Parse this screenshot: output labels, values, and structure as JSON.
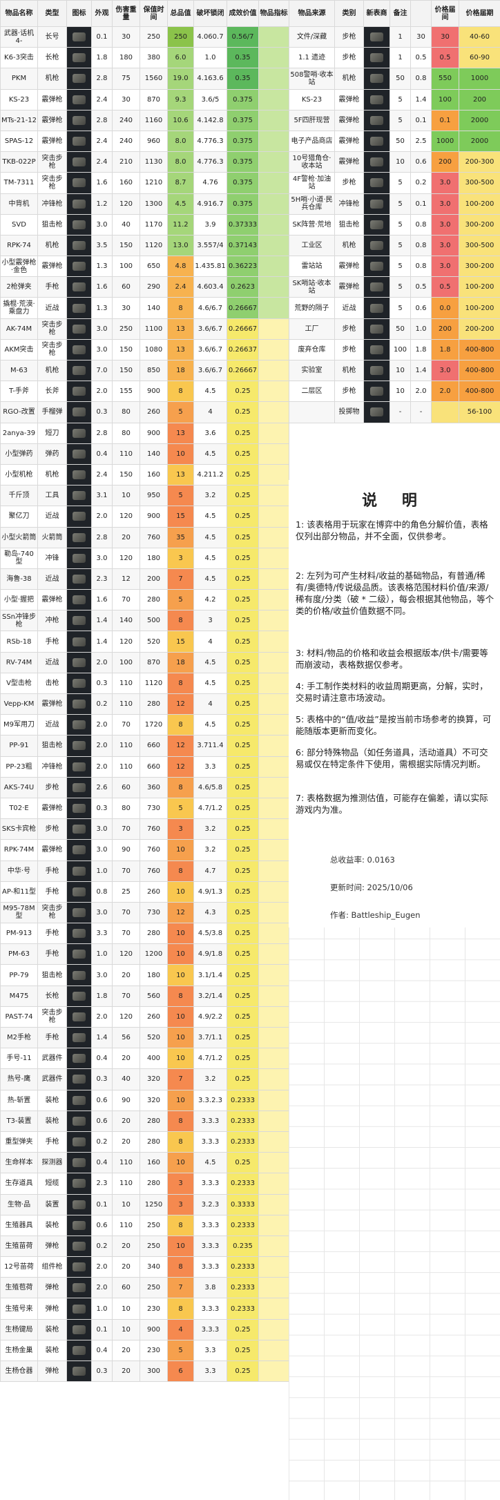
{
  "left_headers": [
    "物品名称",
    "类型",
    "图标",
    "外观",
    "伤害重量",
    "保值时间",
    "总品值",
    "破坏锁闭",
    "成效价值",
    "物品指标"
  ],
  "right_headers": [
    "物品来源",
    "类别",
    "新表商",
    "备注",
    "",
    "价格届间",
    "价格届期"
  ],
  "left_rows": [
    [
      "武器·话机4-",
      "长号",
      "",
      "0.1",
      "30",
      "250",
      "250",
      "4.060.7",
      "0.56/7"
    ],
    [
      "K6-3突击",
      "长枪",
      "",
      "1.8",
      "180",
      "380",
      "6.0",
      "1.0",
      "0.35"
    ],
    [
      "PKM",
      "机枪",
      "",
      "2.8",
      "75",
      "1560",
      "19.0",
      "4.163.6",
      "0.35"
    ],
    [
      "KS-23",
      "霰弹枪",
      "",
      "2.4",
      "30",
      "870",
      "9.3",
      "3.6/5",
      "0.375"
    ],
    [
      "MTs-21-12",
      "霰弹枪",
      "",
      "2.8",
      "240",
      "1160",
      "10.6",
      "4.142.8",
      "0.375"
    ],
    [
      "SPAS-12",
      "霰弹枪",
      "",
      "2.4",
      "240",
      "960",
      "8.0",
      "4.776.3",
      "0.375"
    ],
    [
      "TKB-022P",
      "突击步枪",
      "",
      "2.4",
      "210",
      "1130",
      "8.0",
      "4.776.3",
      "0.375"
    ],
    [
      "TM-7311",
      "突击步枪",
      "",
      "1.6",
      "160",
      "1210",
      "8.7",
      "4.76",
      "0.375"
    ],
    [
      "中背机",
      "冲锋枪",
      "",
      "1.2",
      "120",
      "1300",
      "4.5",
      "4.916.7",
      "0.375"
    ],
    [
      "SVD",
      "狙击枪",
      "",
      "3.0",
      "40",
      "1170",
      "11.2",
      "3.9",
      "0.37333"
    ],
    [
      "RPK-74",
      "机枪",
      "",
      "3.5",
      "150",
      "1120",
      "13.0",
      "3.557/4",
      "0.37143"
    ],
    [
      "小型霰弹枪·金色",
      "霰弹枪",
      "",
      "1.3",
      "100",
      "650",
      "4.8",
      "1.435.81",
      "0.36223"
    ],
    [
      "2枪弹夹",
      "手枪",
      "",
      "1.6",
      "60",
      "290",
      "2.4",
      "4.603.4",
      "0.2623"
    ],
    [
      "撬棍·荒漠·乘盘力",
      "近战",
      "",
      "1.3",
      "30",
      "140",
      "8",
      "4.6/6.7",
      "0.26667"
    ],
    [
      "AK-74M",
      "突击步枪",
      "",
      "3.0",
      "250",
      "1100",
      "13",
      "3.6/6.7",
      "0.26667"
    ],
    [
      "AKM突击",
      "突击步枪",
      "",
      "3.0",
      "150",
      "1080",
      "13",
      "3.6/6.7",
      "0.26637"
    ],
    [
      "M-63",
      "机枪",
      "",
      "7.0",
      "150",
      "850",
      "18",
      "3.6/6.7",
      "0.26667"
    ],
    [
      "T-手斧",
      "长斧",
      "",
      "2.0",
      "155",
      "900",
      "8",
      "4.5",
      "0.25"
    ],
    [
      "RGO-改置",
      "手榴弹",
      "",
      "0.3",
      "80",
      "260",
      "5",
      "4",
      "0.25"
    ],
    [
      "2anya-39",
      "短刀",
      "",
      "2.8",
      "80",
      "900",
      "13",
      "3.6",
      "0.25"
    ],
    [
      "小型弹药",
      "弹药",
      "",
      "0.4",
      "110",
      "140",
      "10",
      "4.5",
      "0.25"
    ],
    [
      "小型机枪",
      "机枪",
      "",
      "2.4",
      "150",
      "160",
      "13",
      "4.211.2",
      "0.25"
    ],
    [
      "千斤顶",
      "工具",
      "",
      "3.1",
      "10",
      "950",
      "5",
      "3.2",
      "0.25"
    ],
    [
      "聚亿刀",
      "近战",
      "",
      "2.0",
      "120",
      "900",
      "15",
      "4.5",
      "0.25"
    ],
    [
      "小型火箭筒",
      "火箭筒",
      "",
      "2.8",
      "20",
      "760",
      "35",
      "4.5",
      "0.25"
    ],
    [
      "勒岛-740型",
      "冲锋",
      "",
      "3.0",
      "120",
      "180",
      "3",
      "4.5",
      "0.25"
    ],
    [
      "海鲁-38",
      "近战",
      "",
      "2.3",
      "12",
      "200",
      "7",
      "4.5",
      "0.25"
    ],
    [
      "小型·握把",
      "霰弹枪",
      "",
      "1.6",
      "70",
      "280",
      "5",
      "4.2",
      "0.25"
    ],
    [
      "SSn冲锋步枪",
      "冲枪",
      "",
      "1.4",
      "140",
      "500",
      "8",
      "3",
      "0.25"
    ],
    [
      "RSb-18",
      "手枪",
      "",
      "1.4",
      "120",
      "520",
      "15",
      "4",
      "0.25"
    ],
    [
      "RV-74M",
      "近战",
      "",
      "2.0",
      "100",
      "870",
      "18",
      "4.5",
      "0.25"
    ],
    [
      "V型击枪",
      "击枪",
      "",
      "0.3",
      "110",
      "1120",
      "8",
      "4.5",
      "0.25"
    ],
    [
      "Vepp-KM",
      "霰弹枪",
      "",
      "0.2",
      "110",
      "280",
      "12",
      "4",
      "0.25"
    ],
    [
      "M9军用刀",
      "近战",
      "",
      "2.0",
      "70",
      "1720",
      "8",
      "4.5",
      "0.25"
    ],
    [
      "PP-91",
      "狙击枪",
      "",
      "2.0",
      "110",
      "660",
      "12",
      "3.711.4",
      "0.25"
    ],
    [
      "PP-23粗",
      "冲锋枪",
      "",
      "2.0",
      "110",
      "660",
      "12",
      "3.3",
      "0.25"
    ],
    [
      "AKS-74U",
      "步枪",
      "",
      "2.6",
      "60",
      "360",
      "8",
      "4.6/5.8",
      "0.25"
    ],
    [
      "T02·E",
      "霰弹枪",
      "",
      "0.3",
      "80",
      "730",
      "5",
      "4.7/1.2",
      "0.25"
    ],
    [
      "SKS卡宾枪",
      "步枪",
      "",
      "3.0",
      "70",
      "760",
      "3",
      "3.2",
      "0.25"
    ],
    [
      "RPK-74M",
      "霰弹枪",
      "",
      "3.0",
      "90",
      "760",
      "10",
      "3.2",
      "0.25"
    ],
    [
      "中华·号",
      "手枪",
      "",
      "1.0",
      "70",
      "760",
      "8",
      "4.7",
      "0.25"
    ],
    [
      "AP-和11型",
      "手枪",
      "",
      "0.8",
      "25",
      "260",
      "10",
      "4.9/1.3",
      "0.25"
    ],
    [
      "M95-78M型",
      "突击步枪",
      "",
      "3.0",
      "70",
      "730",
      "12",
      "4.3",
      "0.25"
    ],
    [
      "PM-913",
      "手枪",
      "",
      "3.3",
      "70",
      "280",
      "10",
      "4.5/3.8",
      "0.25"
    ],
    [
      "PM-63",
      "手枪",
      "",
      "1.0",
      "120",
      "1200",
      "10",
      "4.9/1.8",
      "0.25"
    ],
    [
      "PP-79",
      "狙击枪",
      "",
      "3.0",
      "20",
      "180",
      "10",
      "3.1/1.4",
      "0.25"
    ],
    [
      "M475",
      "长枪",
      "",
      "1.8",
      "70",
      "560",
      "8",
      "3.2/1.4",
      "0.25"
    ],
    [
      "PAST-74",
      "突击步枪",
      "",
      "2.0",
      "120",
      "260",
      "10",
      "4.9/2.2",
      "0.25"
    ],
    [
      "M2手枪",
      "手枪",
      "",
      "1.4",
      "56",
      "520",
      "10",
      "3.7/1.1",
      "0.25"
    ],
    [
      "手号-11",
      "武器件",
      "",
      "0.4",
      "20",
      "400",
      "10",
      "4.7/1.2",
      "0.25"
    ],
    [
      "热号-鹰",
      "武器件",
      "",
      "0.3",
      "40",
      "320",
      "7",
      "3.2",
      "0.25"
    ],
    [
      "热-斩置",
      "装枪",
      "",
      "0.6",
      "90",
      "320",
      "10",
      "3.3.2.3",
      "0.2333"
    ],
    [
      "T3-装置",
      "装枪",
      "",
      "0.6",
      "20",
      "280",
      "8",
      "3.3.3",
      "0.2333"
    ],
    [
      "重型弹夹",
      "手枪",
      "",
      "0.2",
      "20",
      "280",
      "8",
      "3.3.3",
      "0.2333"
    ],
    [
      "生命样本",
      "探测器",
      "",
      "0.4",
      "110",
      "160",
      "10",
      "4.5",
      "0.25"
    ],
    [
      "生存道具",
      "短缆",
      "",
      "2.3",
      "110",
      "280",
      "3",
      "3.3.3",
      "0.2333"
    ],
    [
      "生物·品",
      "装置",
      "",
      "0.1",
      "10",
      "1250",
      "3",
      "3.2.3",
      "0.3333"
    ],
    [
      "生殖器具",
      "装枪",
      "",
      "0.6",
      "110",
      "250",
      "8",
      "3.3.3",
      "0.2333"
    ],
    [
      "生殖苗荷",
      "弹枪",
      "",
      "0.2",
      "20",
      "250",
      "10",
      "3.3.3",
      "0.235"
    ],
    [
      "12号苗荷",
      "组件枪",
      "",
      "2.0",
      "20",
      "340",
      "8",
      "3.3.3",
      "0.2333"
    ],
    [
      "生殖苞荷",
      "弹枪",
      "",
      "2.0",
      "60",
      "250",
      "7",
      "3.8",
      "0.2333"
    ],
    [
      "生殖号来",
      "弹枪",
      "",
      "1.0",
      "10",
      "230",
      "8",
      "3.3.3",
      "0.2333"
    ],
    [
      "生杨键局",
      "装枪",
      "",
      "0.1",
      "10",
      "900",
      "4",
      "3.3.3",
      "0.25"
    ],
    [
      "生杨金巢",
      "装枪",
      "",
      "0.4",
      "20",
      "230",
      "5",
      "3.3",
      "0.25"
    ],
    [
      "生杨仓器",
      "弹枪",
      "",
      "0.3",
      "20",
      "300",
      "6",
      "3.3",
      "0.25"
    ]
  ],
  "right_rows": [
    [
      "文件/深藏",
      "步枪",
      "",
      "1",
      "30",
      "30",
      "40-60"
    ],
    [
      "1.1 遗迹",
      "步枪",
      "",
      "1",
      "0.5",
      "0.5",
      "60-90"
    ],
    [
      "508警哨·收本站",
      "机枪",
      "",
      "50",
      "0.8",
      "550",
      "1000"
    ],
    [
      "KS-23",
      "霰弹枪",
      "",
      "5",
      "1.4",
      "100",
      "200"
    ],
    [
      "5F四肝现营",
      "霰弹枪",
      "",
      "5",
      "0.1",
      "0.1",
      "2000"
    ],
    [
      "电子产品商店",
      "霰弹枪",
      "",
      "50",
      "2.5",
      "1000",
      "2000"
    ],
    [
      "10号猎角仓·收本站",
      "霰弹枪",
      "",
      "10",
      "0.6",
      "200",
      "200-300"
    ],
    [
      "4F警枪·加油站",
      "步枪",
      "",
      "5",
      "0.2",
      "3.0",
      "300-500"
    ],
    [
      "5H哨·小道·民兵仓库",
      "冲锋枪",
      "",
      "5",
      "0.1",
      "3.0",
      "100-200"
    ],
    [
      "SK阵营·荒地",
      "狙击枪",
      "",
      "5",
      "0.8",
      "3.0",
      "300-200"
    ],
    [
      "工业区",
      "机枪",
      "",
      "5",
      "0.8",
      "3.0",
      "300-500"
    ],
    [
      "雷站站",
      "霰弹枪",
      "",
      "5",
      "0.8",
      "3.0",
      "300-200"
    ],
    [
      "SK哨站·收本站",
      "霰弹枪",
      "",
      "5",
      "0.5",
      "0.5",
      "100-200"
    ],
    [
      "荒野的隔子",
      "近战",
      "",
      "5",
      "0.6",
      "0.0",
      "100-200"
    ],
    [
      "工厂",
      "步枪",
      "",
      "50",
      "1.0",
      "200",
      "200-200"
    ],
    [
      "废弃仓库",
      "步枪",
      "",
      "100",
      "1.8",
      "1.8",
      "400-800"
    ],
    [
      "实验室",
      "机枪",
      "",
      "10",
      "1.4",
      "3.0",
      "400-800"
    ],
    [
      "二层区",
      "步枪",
      "",
      "10",
      "2.0",
      "2.0",
      "400-800"
    ],
    [
      "",
      "投掷物",
      "",
      "-",
      "-",
      "",
      "56-100"
    ]
  ],
  "notes": {
    "title": "说 明",
    "items": [
      "1: 该表格用于玩家在博弈中的角色分解价值，表格仅列出部分物品，并不全面，仅供参考。",
      "2: 左列为可产生材料/收益的基础物品，有普通/稀有/奥德特/传说级品质。该表格范围材料价值/来源/稀有度/分类（破 * 二级），每会根据其他物品，等个类的价格/收益价值数据不同。",
      "3: 材料/物品的价格和收益会根据版本/供卡/需要等而崩波动，表格数据仅参考。",
      "4: 手工制作类材料的收益周期更高，分解，实时，交易时请注意市场波动。",
      "5: 表格中的“值/收益”是按当前市场参考的换算，可能随版本更新而变化。",
      "6: 部分特殊物品（如任务道具，活动道具）不可交易或仅在特定条件下使用，需根据实际情况判断。",
      "7: 表格数据为推测估值，可能存在偏差，请以实际游戏内为准。"
    ],
    "total_label": "总收益率: ",
    "total_value": "0.0163",
    "updated_label": "更新时间: ",
    "updated_value": "2025/10/06",
    "author_label": "作者: ",
    "author_value": "Battleship_Eugen"
  },
  "colors": {
    "total_high": "#4caf50",
    "total_mid": "#f5e04a",
    "total_low": "#f08a5d",
    "value_green": "#5cb85c",
    "value_yellow": "#f6e96b",
    "price_red": "#f07070",
    "price_orange": "#f7a040",
    "price_yellow": "#f9e27a",
    "price_green": "#7ecb5a"
  }
}
